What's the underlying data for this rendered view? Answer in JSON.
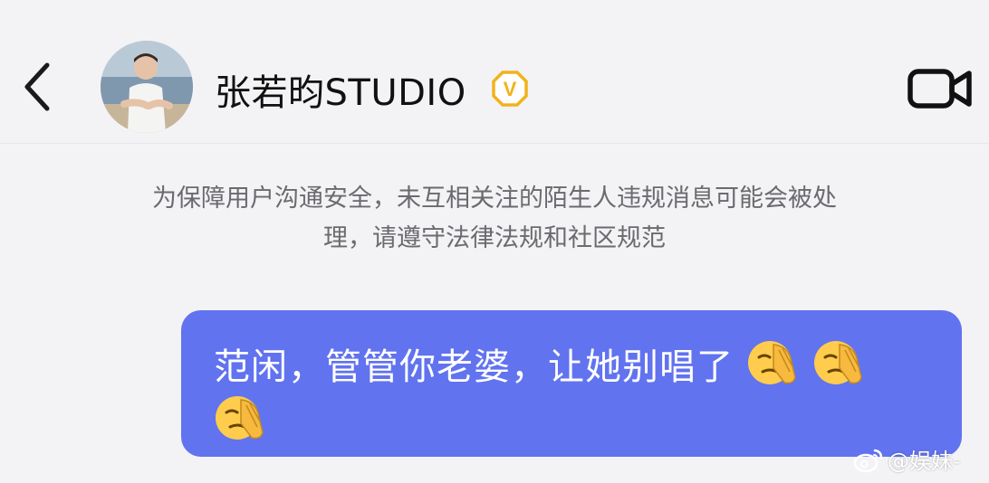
{
  "header": {
    "title": "张若昀STUDIO",
    "back_icon": "chevron-left-icon",
    "verified_badge_letter": "V",
    "video_icon": "video-camera-icon"
  },
  "notice": {
    "line1": "为保障用户沟通安全，未互相关注的陌生人违规消息可能会被处",
    "line2": "理，请遵守法律法规和社区规范"
  },
  "message": {
    "text": "范闲，管管你老婆，让她别唱了",
    "emoji": "face-palm-emoji",
    "bubble_color": "#6173ef"
  },
  "watermark": {
    "text": "@娱妹-",
    "icon": "weibo-logo-icon"
  }
}
